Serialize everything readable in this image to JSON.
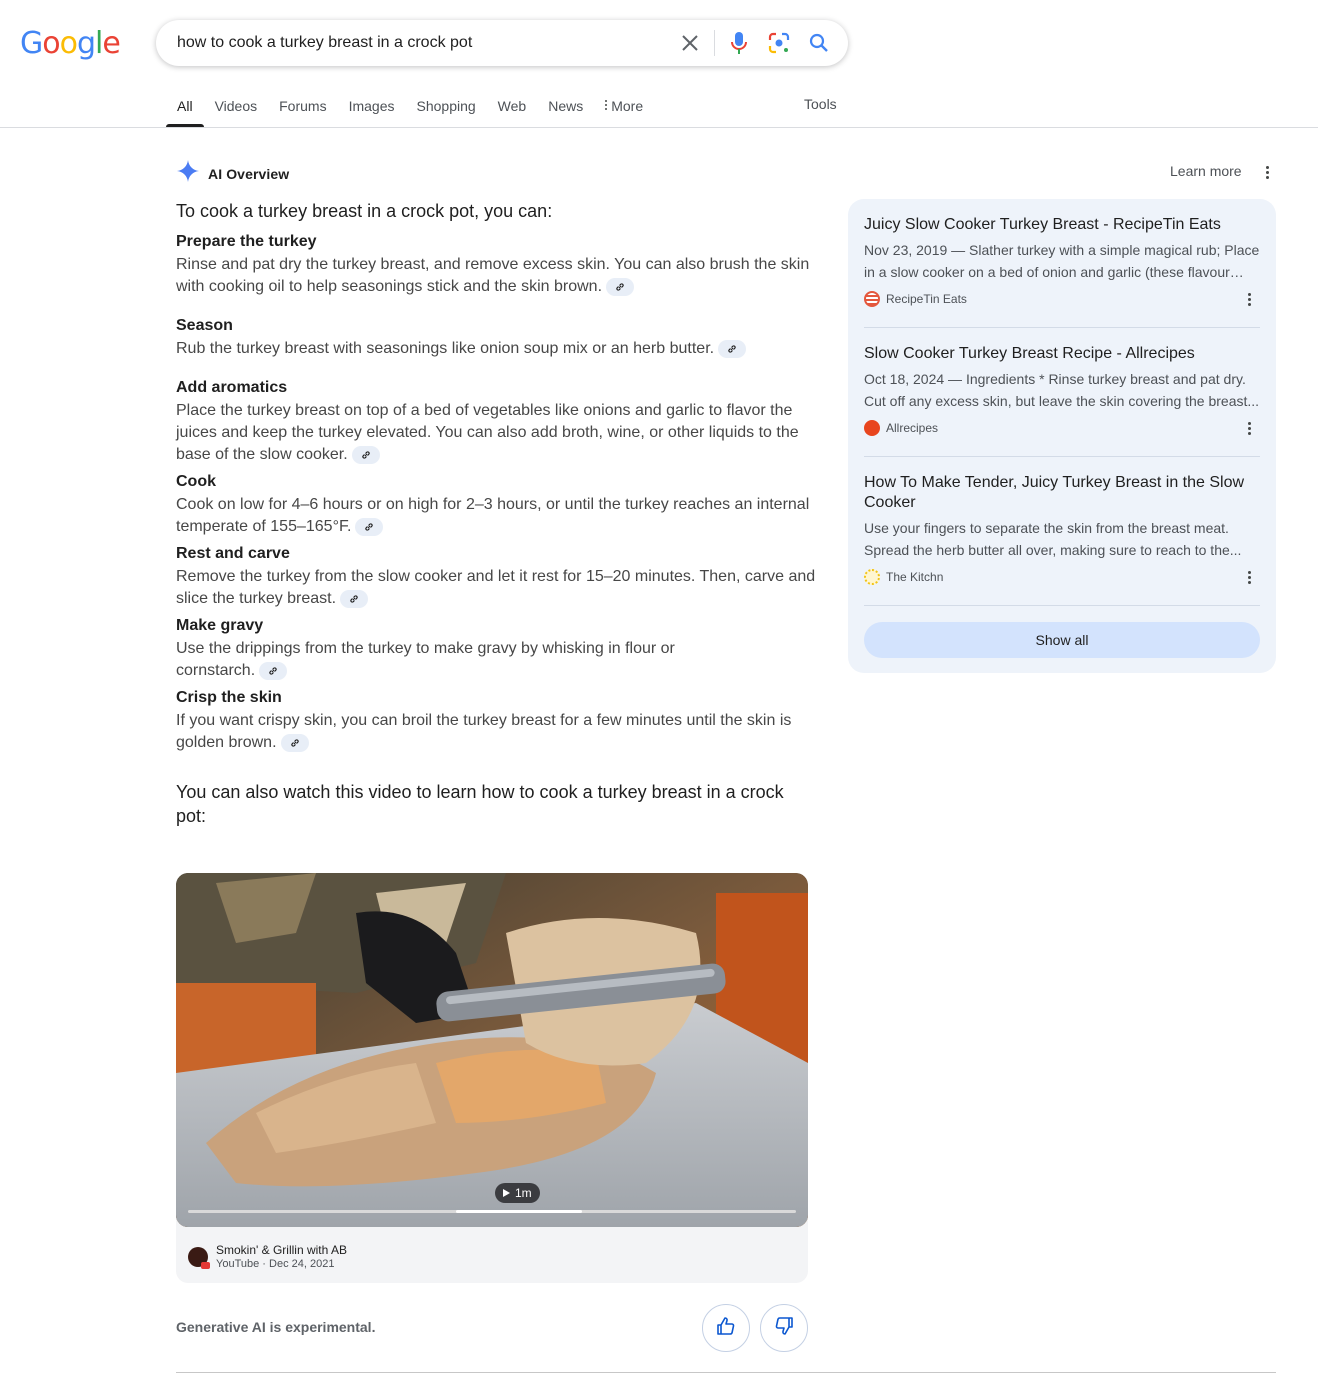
{
  "logo": {
    "letters": [
      "G",
      "o",
      "o",
      "g",
      "l",
      "e"
    ],
    "colors": [
      "#4285f4",
      "#ea4335",
      "#fbbc05",
      "#4285f4",
      "#34a853",
      "#ea4335"
    ]
  },
  "search": {
    "query": "how to cook a turkey breast in a crock pot",
    "icons": [
      "clear-icon",
      "microphone-icon",
      "lens-icon",
      "search-icon"
    ]
  },
  "tabs": [
    {
      "label": "All",
      "active": true
    },
    {
      "label": "Videos"
    },
    {
      "label": "Forums"
    },
    {
      "label": "Images"
    },
    {
      "label": "Shopping"
    },
    {
      "label": "Web"
    },
    {
      "label": "News"
    },
    {
      "label": "More"
    }
  ],
  "tools_label": "Tools",
  "ai_overview": {
    "title": "AI Overview",
    "learn_more": "Learn more",
    "intro": "To cook a turkey breast in a crock pot, you can:",
    "steps": [
      {
        "title": "Prepare the turkey",
        "text": "Rinse and pat dry the turkey breast, and remove excess skin. You can also brush the skin with cooking oil to help seasonings stick and the skin brown."
      },
      {
        "title": "Season",
        "text": "Rub the turkey breast with seasonings like onion soup mix or an herb butter."
      },
      {
        "title": "Add aromatics",
        "text": "Place the turkey breast on top of a bed of vegetables like onions and garlic to flavor the juices and keep the turkey elevated. You can also add broth, wine, or other liquids to the base of the slow cooker."
      },
      {
        "title": "Cook",
        "text": "Cook on low for 4–6 hours or on high for 2–3 hours, or until the turkey reaches an internal temperate of 155–165°F."
      },
      {
        "title": "Rest and carve",
        "text": "Remove the turkey from the slow cooker and let it rest for 15–20 minutes. Then, carve and slice the turkey breast."
      },
      {
        "title": "Make gravy",
        "text": "Use the drippings from the turkey to make gravy by whisking in flour or cornstarch."
      },
      {
        "title": "Crisp the skin",
        "text": "If you want crispy skin, you can broil the turkey breast for a few minutes until the skin is golden brown."
      }
    ],
    "video_intro": "You can also watch this video to learn how to cook a turkey breast in a crock pot:",
    "video": {
      "duration": "1m",
      "channel": "Smokin' & Grillin with AB",
      "platform_date": "YouTube · Dec 24, 2021",
      "progress": 0.2
    },
    "experimental": "Generative AI is experimental."
  },
  "sources": [
    {
      "title": "Juicy Slow Cooker Turkey Breast - RecipeTin Eats",
      "snippet": "Nov 23, 2019 — Slather turkey with a simple magical rub; Place in a slow cooker on a bed of onion and garlic (these flavour the...",
      "site": "RecipeTin Eats",
      "favicon_color": "#e4573d"
    },
    {
      "title": "Slow Cooker Turkey Breast Recipe - Allrecipes",
      "snippet": "Oct 18, 2024 — Ingredients * Rinse turkey breast and pat dry. Cut off any excess skin, but leave the skin covering the breast...",
      "site": "Allrecipes",
      "favicon_color": "#e8451e"
    },
    {
      "title": "How To Make Tender, Juicy Turkey Breast in the Slow Cooker",
      "snippet": "Use your fingers to separate the skin from the breast meat. Spread the herb butter all over, making sure to reach to the...",
      "site": "The Kitchn",
      "favicon_color": "#f2c417"
    }
  ],
  "show_all": "Show all"
}
